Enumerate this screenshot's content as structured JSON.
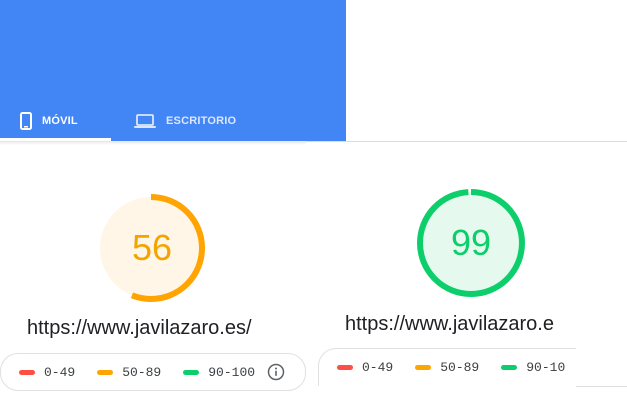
{
  "tabs": [
    {
      "label": "MÓVIL",
      "icon": "smartphone-icon",
      "selected": true
    },
    {
      "label": "ESCRITORIO",
      "icon": "laptop-icon",
      "selected": false
    }
  ],
  "colors": {
    "header": "#4285f4",
    "average": "#ffa400",
    "average_bg": "#fff6e8",
    "good": "#0cce6b",
    "good_bg": "#e6f9ee",
    "fail": "#ff4e42"
  },
  "results": [
    {
      "score": "56",
      "score_value": 56,
      "rating": "average",
      "url": "https://www.javilazaro.es/"
    },
    {
      "score": "99",
      "score_value": 99,
      "rating": "good",
      "url": "https://www.javilazaro.e"
    }
  ],
  "legend": [
    {
      "range": "0-49",
      "color": "#ff4e42"
    },
    {
      "range": "50-89",
      "color": "#ffa400"
    },
    {
      "range": "90-100",
      "color": "#0cce6b"
    }
  ],
  "legend_partial": [
    {
      "range": "0-49",
      "color": "#ff4e42"
    },
    {
      "range": "50-89",
      "color": "#ffa400"
    },
    {
      "range": "90-10",
      "color": "#0cce6b"
    }
  ],
  "legend_info_icon": "info-icon"
}
